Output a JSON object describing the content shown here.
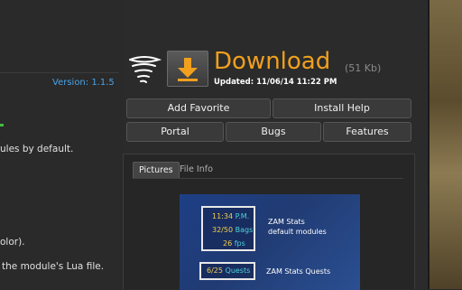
{
  "content": {
    "version": "Version: 1.1.5",
    "lines": [
      "ules by default.",
      "olor).",
      "the module's Lua file."
    ]
  },
  "download": {
    "label": "Download",
    "size": "(51 Kb)",
    "updated": "Updated: 11/06/14 11:22 PM"
  },
  "actions": {
    "add_favorite": "Add Favorite",
    "install_help": "Install Help",
    "portal": "Portal",
    "bugs": "Bugs",
    "features": "Features"
  },
  "tabs": {
    "pictures": "Pictures",
    "file_info": "File Info"
  },
  "preview": {
    "box1": {
      "time": "11:34",
      "time_suffix": "P.M.",
      "bags": "32/50",
      "bags_label": "Bags",
      "fps": "26",
      "fps_label": "fps"
    },
    "caption1_line1": "ZAM Stats",
    "caption1_line2": "default modules",
    "box2": {
      "quests": "6/25",
      "quests_label": "Quests"
    },
    "caption2": "ZAM Stats Quests"
  },
  "colors": {
    "accent": "#f0a01e",
    "link": "#4aa3e6"
  }
}
